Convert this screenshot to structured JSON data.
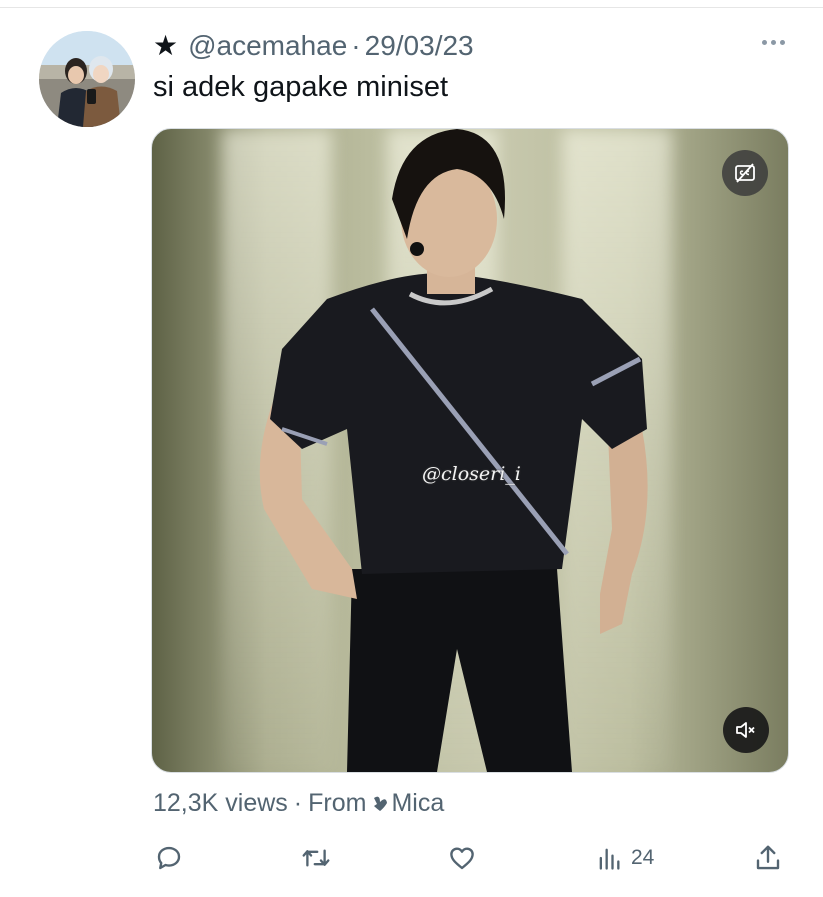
{
  "tweet": {
    "author_star": "★",
    "handle": "@acemahae",
    "separator": "·",
    "date": "29/03/23",
    "text": "si adek gapake miniset",
    "avatar_icon": "avatar-photo"
  },
  "media": {
    "watermark": "@closeri_i",
    "cc_icon": "captions-off-icon",
    "mute_icon": "muted-speaker-icon"
  },
  "meta": {
    "views": "12,3K views",
    "separator": "·",
    "from_label": "From",
    "source_name": "Mica"
  },
  "actions": {
    "reply_icon": "reply-icon",
    "retweet_icon": "retweet-icon",
    "like_icon": "like-icon",
    "views_icon": "views-icon",
    "views_count": "24",
    "share_icon": "share-icon"
  },
  "colors": {
    "text_primary": "#0f1419",
    "text_secondary": "#536471",
    "border": "#d9dee2"
  }
}
